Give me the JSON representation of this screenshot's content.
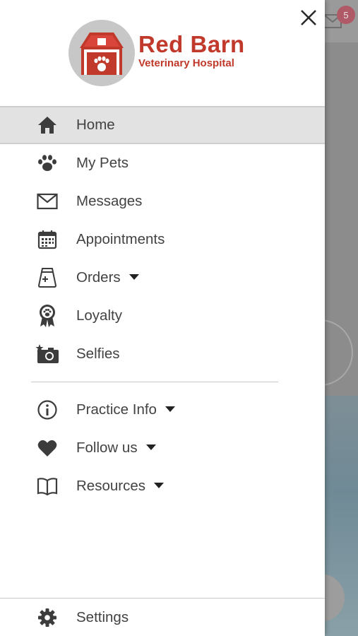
{
  "background": {
    "notification_count": "5"
  },
  "logo": {
    "title": "Red Barn",
    "subtitle": "Veterinary Hospital"
  },
  "colors": {
    "brand_red": "#c0392b",
    "active_bg": "#e2e2e2",
    "text": "#424242"
  },
  "menu": {
    "items": [
      {
        "label": "Home",
        "icon": "home-icon",
        "active": true
      },
      {
        "label": "My Pets",
        "icon": "paw-icon"
      },
      {
        "label": "Messages",
        "icon": "envelope-icon"
      },
      {
        "label": "Appointments",
        "icon": "calendar-icon"
      },
      {
        "label": "Orders",
        "icon": "pet-food-bag-icon",
        "has_dropdown": true
      },
      {
        "label": "Loyalty",
        "icon": "award-ribbon-icon"
      },
      {
        "label": "Selfies",
        "icon": "camera-icon"
      }
    ]
  },
  "menu2": {
    "items": [
      {
        "label": "Practice Info",
        "icon": "info-icon",
        "has_dropdown": true
      },
      {
        "label": "Follow us",
        "icon": "heart-icon",
        "has_dropdown": true
      },
      {
        "label": "Resources",
        "icon": "book-icon",
        "has_dropdown": true
      }
    ]
  },
  "settings": {
    "label": "Settings",
    "icon": "gear-icon"
  }
}
